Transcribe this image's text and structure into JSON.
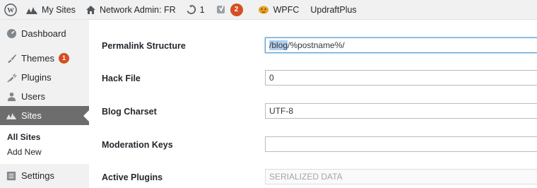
{
  "adminbar": {
    "my_sites": "My Sites",
    "network_admin": "Network Admin: FR",
    "updates_count": "1",
    "yoast_badge": "2",
    "wpfc": "WPFC",
    "updraft": "UpdraftPlus"
  },
  "sidebar": {
    "dashboard": "Dashboard",
    "themes": "Themes",
    "themes_badge": "1",
    "plugins": "Plugins",
    "users": "Users",
    "sites": "Sites",
    "sub_all_sites": "All Sites",
    "sub_add_new": "Add New",
    "settings": "Settings"
  },
  "form": {
    "permalink_label": "Permalink Structure",
    "permalink_selected": "/blog",
    "permalink_rest": "/%postname%/",
    "hack_label": "Hack File",
    "hack_value": "0",
    "charset_label": "Blog Charset",
    "charset_value": "UTF-8",
    "moderation_label": "Moderation Keys",
    "moderation_value": "",
    "plugins_label": "Active Plugins",
    "plugins_value": "SERIALIZED DATA"
  },
  "colors": {
    "accent": "#0073aa",
    "badge": "#d54e21",
    "current_menu_bg": "#6d6d6d",
    "focus_border": "#5b9dd9"
  }
}
